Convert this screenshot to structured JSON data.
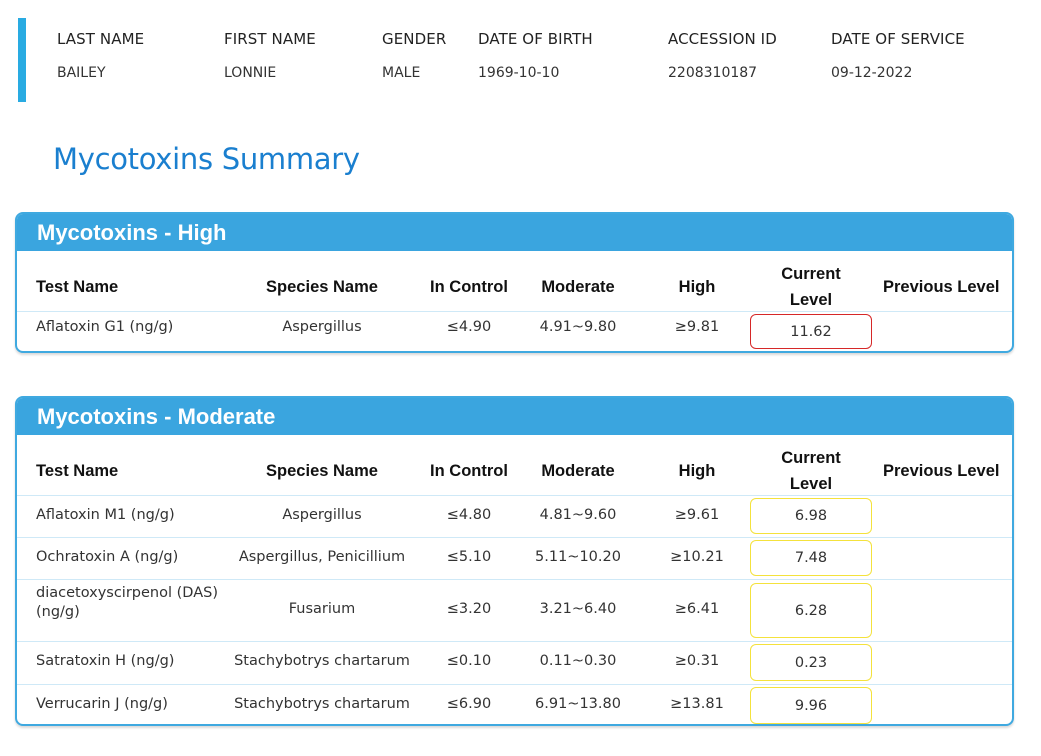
{
  "patient": {
    "headers": [
      "LAST NAME",
      "FIRST NAME",
      "GENDER",
      "DATE OF BIRTH",
      "ACCESSION ID",
      "DATE OF SERVICE"
    ],
    "values": [
      "BAILEY",
      "LONNIE",
      "MALE",
      "1969-10-10",
      "2208310187",
      "09-12-2022"
    ]
  },
  "summary_title": "Mycotoxins Summary",
  "columns": {
    "test_name": "Test Name",
    "species_name": "Species Name",
    "in_control": "In Control",
    "moderate": "Moderate",
    "high": "High",
    "current_level_1": "Current",
    "current_level_2": "Level",
    "previous_level": "Previous Level"
  },
  "high_section": {
    "title": "Mycotoxins - High",
    "rows": [
      {
        "test": "Aflatoxin G1 (ng/g)",
        "species": "Aspergillus",
        "in_control": "≤4.90",
        "moderate": "4.91~9.80",
        "high": "≥9.81",
        "current": "11.62",
        "previous": ""
      }
    ]
  },
  "moderate_section": {
    "title": "Mycotoxins - Moderate",
    "rows": [
      {
        "test": "Aflatoxin M1 (ng/g)",
        "species": "Aspergillus",
        "in_control": "≤4.80",
        "moderate": "4.81~9.60",
        "high": "≥9.61",
        "current": "6.98",
        "previous": ""
      },
      {
        "test": "Ochratoxin A (ng/g)",
        "species": "Aspergillus, Penicillium",
        "in_control": "≤5.10",
        "moderate": "5.11~10.20",
        "high": "≥10.21",
        "current": "7.48",
        "previous": ""
      },
      {
        "test": "diacetoxyscirpenol (DAS) (ng/g)",
        "species": "Fusarium",
        "in_control": "≤3.20",
        "moderate": "3.21~6.40",
        "high": "≥6.41",
        "current": "6.28",
        "previous": ""
      },
      {
        "test": "Satratoxin H (ng/g)",
        "species": "Stachybotrys chartarum",
        "in_control": "≤0.10",
        "moderate": "0.11~0.30",
        "high": "≥0.31",
        "current": "0.23",
        "previous": ""
      },
      {
        "test": "Verrucarin J (ng/g)",
        "species": "Stachybotrys chartarum",
        "in_control": "≤6.90",
        "moderate": "6.91~13.80",
        "high": "≥13.81",
        "current": "9.96",
        "previous": ""
      }
    ]
  },
  "colors": {
    "accent": "#29abe2",
    "section_header": "#3aa5df",
    "title": "#1a7fcf",
    "high_flag": "#d62828",
    "moderate_flag": "#f4e23c"
  }
}
